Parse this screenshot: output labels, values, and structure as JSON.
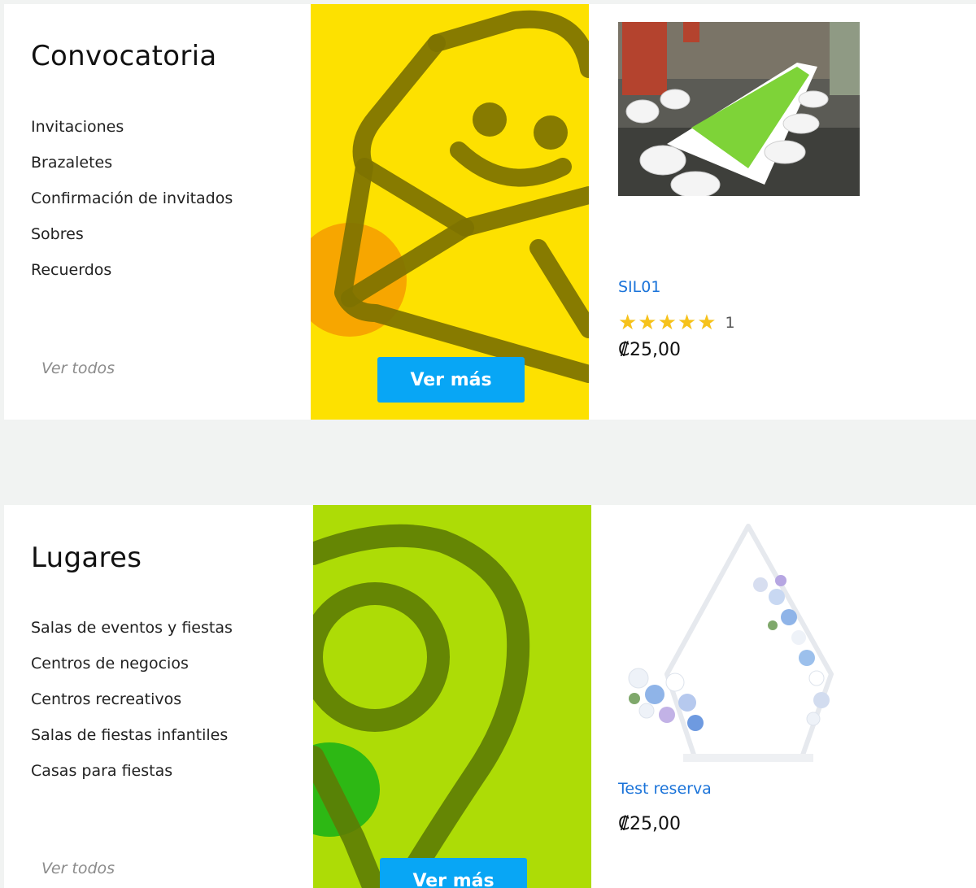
{
  "sections": [
    {
      "title": "Convocatoria",
      "links": [
        "Invitaciones",
        "Brazaletes",
        "Confirmación de invitados",
        "Sobres",
        "Recuerdos"
      ],
      "see_all": "Ver todos",
      "banner_button": "Ver más",
      "banner_color": "#fde100",
      "banner_icon": "envelope-smiley-icon",
      "product": {
        "name": "SIL01",
        "rating": 5,
        "stars": "★★★★★",
        "rating_count": "1",
        "price": "₡25,00"
      }
    },
    {
      "title": "Lugares",
      "links": [
        "Salas de eventos y fiestas",
        "Centros de negocios",
        "Centros recreativos",
        "Salas de fiestas infantiles",
        "Casas para fiestas"
      ],
      "see_all": "Ver todos",
      "banner_button": "Ver más",
      "banner_color": "#addc06",
      "banner_icon": "location-pin-icon",
      "product": {
        "name": "Test reserva",
        "price": "₡25,00"
      }
    }
  ],
  "colors": {
    "accent_button": "#08a6f5",
    "link": "#1a73d9",
    "star": "#f6c21b"
  }
}
